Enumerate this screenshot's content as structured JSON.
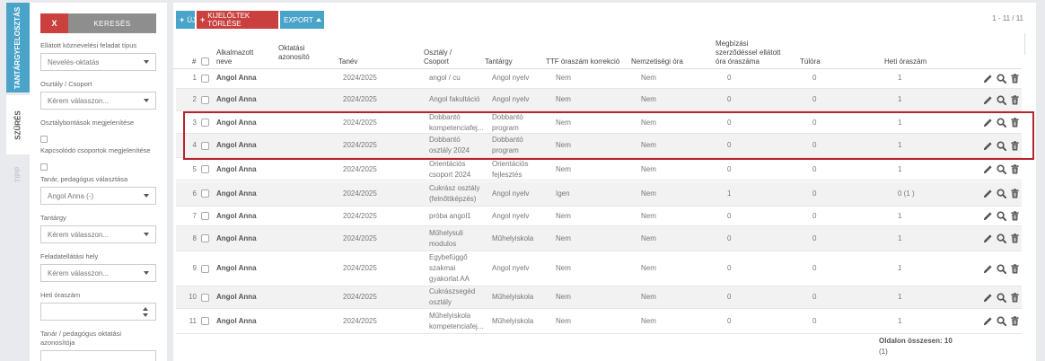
{
  "tabs": [
    "TANTÁRGYFELOSZTÁS",
    "SZŰRÉS",
    "TIPP"
  ],
  "filters": {
    "clear_label": "X",
    "search_label": "KERESÉS",
    "task_type_label": "Ellátott köznevelési feladat típus",
    "task_type_value": "Nevelés-oktatás",
    "class_label": "Osztály / Csoport",
    "class_value": "Kérem válasszon...",
    "show_splits_label": "Osztálybontások megjelenítése",
    "show_linked_label": "Kapcsolódó csoportok megjelenítése",
    "teacher_label": "Tanár, pedagógus választása",
    "teacher_value": "Angol Anna (-)",
    "subject_label": "Tantárgy",
    "subject_value": "Kérem válasszon...",
    "location_label": "Feladatellátási hely",
    "location_value": "Kérem válasszon...",
    "weekly_hours_label": "Heti óraszám",
    "teacher_id_label": "Tanár / pedagógus oktatási azonosítója"
  },
  "toolbar": {
    "new_label": "ÚJ",
    "delete_label": "KIJELÖLTEK TÖRLÉSE",
    "export_label": "EXPORT",
    "pager": "1 - 11 / 11"
  },
  "columns": {
    "idx": "#",
    "employee": [
      "Alkalmazott",
      "neve"
    ],
    "edu_id": [
      "Oktatási",
      "azonosító"
    ],
    "year": "Tanév",
    "class": [
      "Osztály /",
      "Csoport"
    ],
    "subject": "Tantárgy",
    "ttf": "TTF óraszám korrekció",
    "ethnic": "Nemzetiségi óra",
    "contract": [
      "Megbízási",
      "szerződéssel ellátott",
      "óra óraszáma"
    ],
    "overtime": "Túlóra",
    "weekly": "Heti óraszám"
  },
  "rows": [
    {
      "n": "1",
      "name": "Angol Anna",
      "year": "2024/2025",
      "cls": [
        "angol / cu"
      ],
      "subj": [
        "Angol nyelv"
      ],
      "ttf": "Nem",
      "eth": "Nem",
      "con": "0",
      "over": "0",
      "week": "1"
    },
    {
      "n": "2",
      "name": "Angol Anna",
      "year": "2024/2025",
      "cls": [
        "Angol fakultáció"
      ],
      "subj": [
        "Angol nyelv"
      ],
      "ttf": "Nem",
      "eth": "Nem",
      "con": "0",
      "over": "0",
      "week": "1"
    },
    {
      "n": "3",
      "name": "Angol Anna",
      "year": "2024/2025",
      "cls": [
        "Dobbantó",
        "kompetenciafej..."
      ],
      "subj": [
        "Dobbantó",
        "program"
      ],
      "ttf": "Nem",
      "eth": "Nem",
      "con": "0",
      "over": "0",
      "week": "1"
    },
    {
      "n": "4",
      "name": "Angol Anna",
      "year": "2024/2025",
      "cls": [
        "Dobbantó",
        "osztály 2024"
      ],
      "subj": [
        "Dobbantó",
        "program"
      ],
      "ttf": "Nem",
      "eth": "Nem",
      "con": "0",
      "over": "0",
      "week": "1"
    },
    {
      "n": "5",
      "name": "Angol Anna",
      "year": "2024/2025",
      "cls": [
        "Orientációs",
        "csoport 2024"
      ],
      "subj": [
        "Orientációs",
        "fejlesztés"
      ],
      "ttf": "Nem",
      "eth": "Nem",
      "con": "0",
      "over": "0",
      "week": "1"
    },
    {
      "n": "6",
      "name": "Angol Anna",
      "year": "2024/2025",
      "cls": [
        "Cukrász osztály",
        "(felnőttképzés)"
      ],
      "subj": [
        "Angol nyelv"
      ],
      "ttf": "Igen",
      "eth": "Nem",
      "con": "1",
      "over": "0",
      "week": "0 (1 )"
    },
    {
      "n": "7",
      "name": "Angol Anna",
      "year": "2024/2025",
      "cls": [
        "próba angol1"
      ],
      "subj": [
        "Angol nyelv"
      ],
      "ttf": "Nem",
      "eth": "Nem",
      "con": "0",
      "over": "0",
      "week": "1"
    },
    {
      "n": "8",
      "name": "Angol Anna",
      "year": "2024/2025",
      "cls": [
        "Műhelysuli",
        "modulos"
      ],
      "subj": [
        "Műhelyiskola"
      ],
      "ttf": "Nem",
      "eth": "Nem",
      "con": "0",
      "over": "0",
      "week": "1"
    },
    {
      "n": "9",
      "name": "Angol Anna",
      "year": "2024/2025",
      "cls": [
        "Egybefüggő",
        "szakmai",
        "gyakorlat AA"
      ],
      "subj": [
        "Angol nyelv"
      ],
      "ttf": "Nem",
      "eth": "Nem",
      "con": "0",
      "over": "0",
      "week": "1"
    },
    {
      "n": "10",
      "name": "Angol Anna",
      "year": "2024/2025",
      "cls": [
        "Cukrászsegéd",
        "osztály"
      ],
      "subj": [
        "Műhelyiskola"
      ],
      "ttf": "Nem",
      "eth": "Nem",
      "con": "0",
      "over": "0",
      "week": "1"
    },
    {
      "n": "11",
      "name": "Angol Anna",
      "year": "2024/2025",
      "cls": [
        "Műhelyiskola",
        "kompetenciafej..."
      ],
      "subj": [
        "Műhelyiskola"
      ],
      "ttf": "Nem",
      "eth": "Nem",
      "con": "0",
      "over": "0",
      "week": "1"
    }
  ],
  "footer": {
    "page_total_label": "Oldalon összesen: 10",
    "page_total_extra": "(1)"
  },
  "icons": [
    "pencil-icon",
    "search-icon",
    "trash-icon"
  ],
  "colors": {
    "accent": "#4aa3c9",
    "danger": "#c9403e",
    "highlight": "#b8242c"
  }
}
